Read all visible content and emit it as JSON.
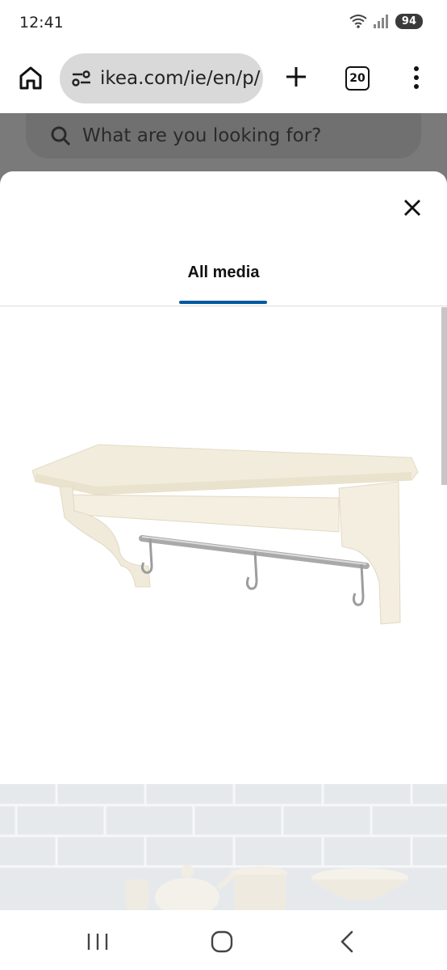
{
  "status_bar": {
    "time": "12:41",
    "battery": "94",
    "icons": [
      "wifi-icon",
      "signal-icon"
    ]
  },
  "browser": {
    "url": "ikea.com/ie/en/p/",
    "tab_count": "20",
    "icons": [
      "home-icon",
      "site-info-icon",
      "new-tab-icon",
      "tabs-icon",
      "more-menu-icon"
    ]
  },
  "background_page": {
    "search_placeholder": "What are you looking for?"
  },
  "media_modal": {
    "tabs": [
      {
        "label": "All media",
        "selected": true
      }
    ],
    "accent_color": "#0058a3",
    "images": [
      "wall shelf with rail and hooks",
      "kitchen wall with tableware"
    ]
  },
  "system_nav": {
    "icons": [
      "recents-icon",
      "home-icon",
      "back-icon"
    ]
  }
}
